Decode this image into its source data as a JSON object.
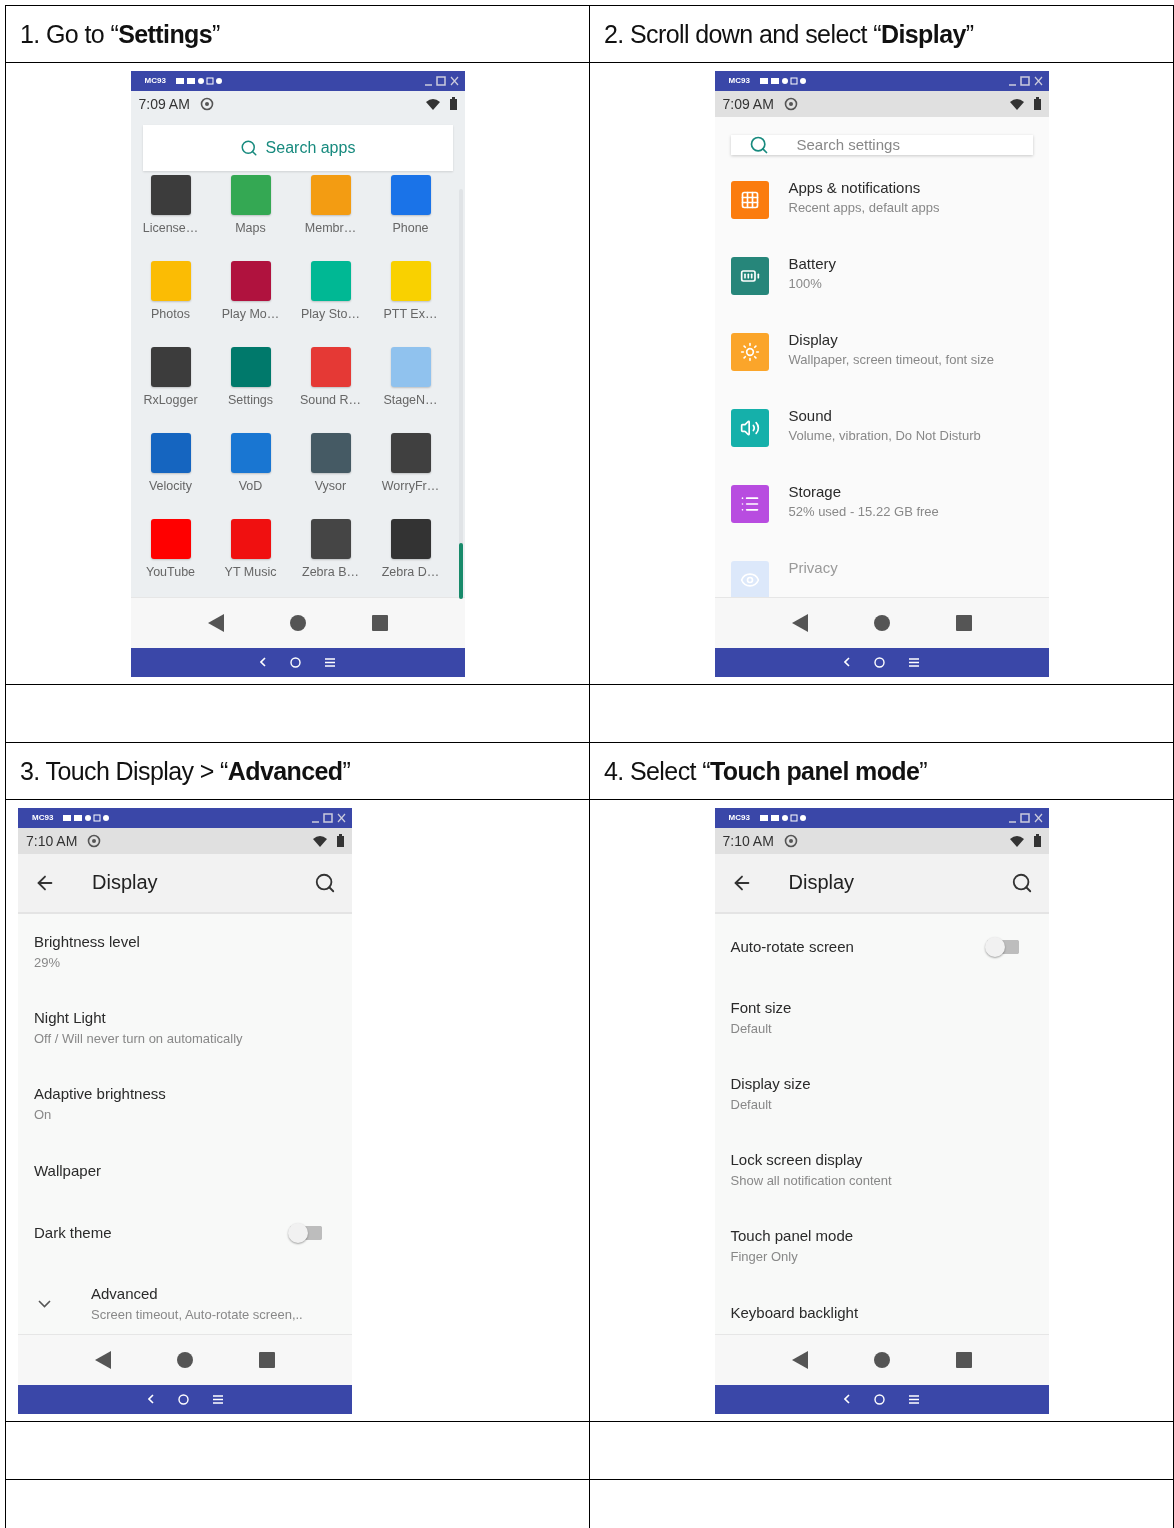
{
  "steps": [
    {
      "caption": "1. Go to “**Settings**”",
      "screen": {
        "kind": "launcher",
        "device": "MC93",
        "time": "7:09 AM",
        "search": {
          "placeholder": "Search apps"
        },
        "apps": [
          {
            "label": "License…",
            "color": "#3c3c3c"
          },
          {
            "label": "Maps",
            "color": "#34a853"
          },
          {
            "label": "Membr…",
            "color": "#f39c12"
          },
          {
            "label": "Phone",
            "color": "#1a73e8"
          },
          {
            "label": "Photos",
            "color": "#fbbc04"
          },
          {
            "label": "Play Mo…",
            "color": "#b0123e"
          },
          {
            "label": "Play Sto…",
            "color": "#00b894"
          },
          {
            "label": "PTT Ex…",
            "color": "#f9d100"
          },
          {
            "label": "RxLogger",
            "color": "#3c3c3c"
          },
          {
            "label": "Settings",
            "color": "#00796b"
          },
          {
            "label": "Sound R…",
            "color": "#e53935"
          },
          {
            "label": "StageN…",
            "color": "#90c2ee"
          },
          {
            "label": "Velocity",
            "color": "#1565c0"
          },
          {
            "label": "VoD",
            "color": "#1976d2"
          },
          {
            "label": "Vysor",
            "color": "#455a64"
          },
          {
            "label": "WorryFr…",
            "color": "#404040"
          },
          {
            "label": "YouTube",
            "color": "#ff0000"
          },
          {
            "label": "YT Music",
            "color": "#f01010"
          },
          {
            "label": "Zebra B…",
            "color": "#454545"
          },
          {
            "label": "Zebra D…",
            "color": "#333333"
          }
        ]
      }
    },
    {
      "caption": "2. Scroll down and select “**Display**”",
      "screen": {
        "kind": "settings",
        "device": "MC93",
        "time": "7:09 AM",
        "search": {
          "placeholder": "Search settings"
        },
        "items": [
          {
            "title": "Apps & notifications",
            "subtitle": "Recent apps, default apps",
            "color": "#fb7c0e",
            "faded": false
          },
          {
            "title": "Battery",
            "subtitle": "100%",
            "color": "#26867a",
            "faded": false
          },
          {
            "title": "Display",
            "subtitle": "Wallpaper, screen timeout, font size",
            "color": "#fba52a",
            "faded": false
          },
          {
            "title": "Sound",
            "subtitle": "Volume, vibration, Do Not Disturb",
            "color": "#15b0aa",
            "faded": false
          },
          {
            "title": "Storage",
            "subtitle": "52% used - 15.22 GB free",
            "color": "#b84ce0",
            "faded": false
          },
          {
            "title": "Privacy",
            "color": "#dce8fa",
            "faded": true
          }
        ]
      }
    },
    {
      "caption": "3. Touch Display > “**Advanced**”",
      "screen": {
        "kind": "display",
        "device": "MC93",
        "time": "7:10 AM",
        "title": "Display",
        "items": [
          {
            "kind": "text",
            "title": "Brightness level",
            "subtitle": "29%"
          },
          {
            "kind": "text",
            "title": "Night Light",
            "subtitle": "Off / Will never turn on automatically"
          },
          {
            "kind": "text",
            "title": "Adaptive brightness",
            "subtitle": "On"
          },
          {
            "kind": "text",
            "title": "Wallpaper"
          },
          {
            "kind": "toggle",
            "title": "Dark theme",
            "on": false
          },
          {
            "kind": "expand",
            "title": "Advanced",
            "subtitle": "Screen timeout, Auto-rotate screen,.."
          }
        ]
      }
    },
    {
      "caption": "4. Select “**Touch panel mode**”",
      "screen": {
        "kind": "display",
        "device": "MC93",
        "time": "7:10 AM",
        "title": "Display",
        "items": [
          {
            "kind": "toggle",
            "title": "Auto-rotate screen",
            "on": false
          },
          {
            "kind": "text",
            "title": "Font size",
            "subtitle": "Default"
          },
          {
            "kind": "text",
            "title": "Display size",
            "subtitle": "Default"
          },
          {
            "kind": "text",
            "title": "Lock screen display",
            "subtitle": "Show all notification content"
          },
          {
            "kind": "text",
            "title": "Touch panel mode",
            "subtitle": "Finger Only"
          },
          {
            "kind": "text",
            "title": "Keyboard backlight"
          }
        ]
      }
    }
  ]
}
